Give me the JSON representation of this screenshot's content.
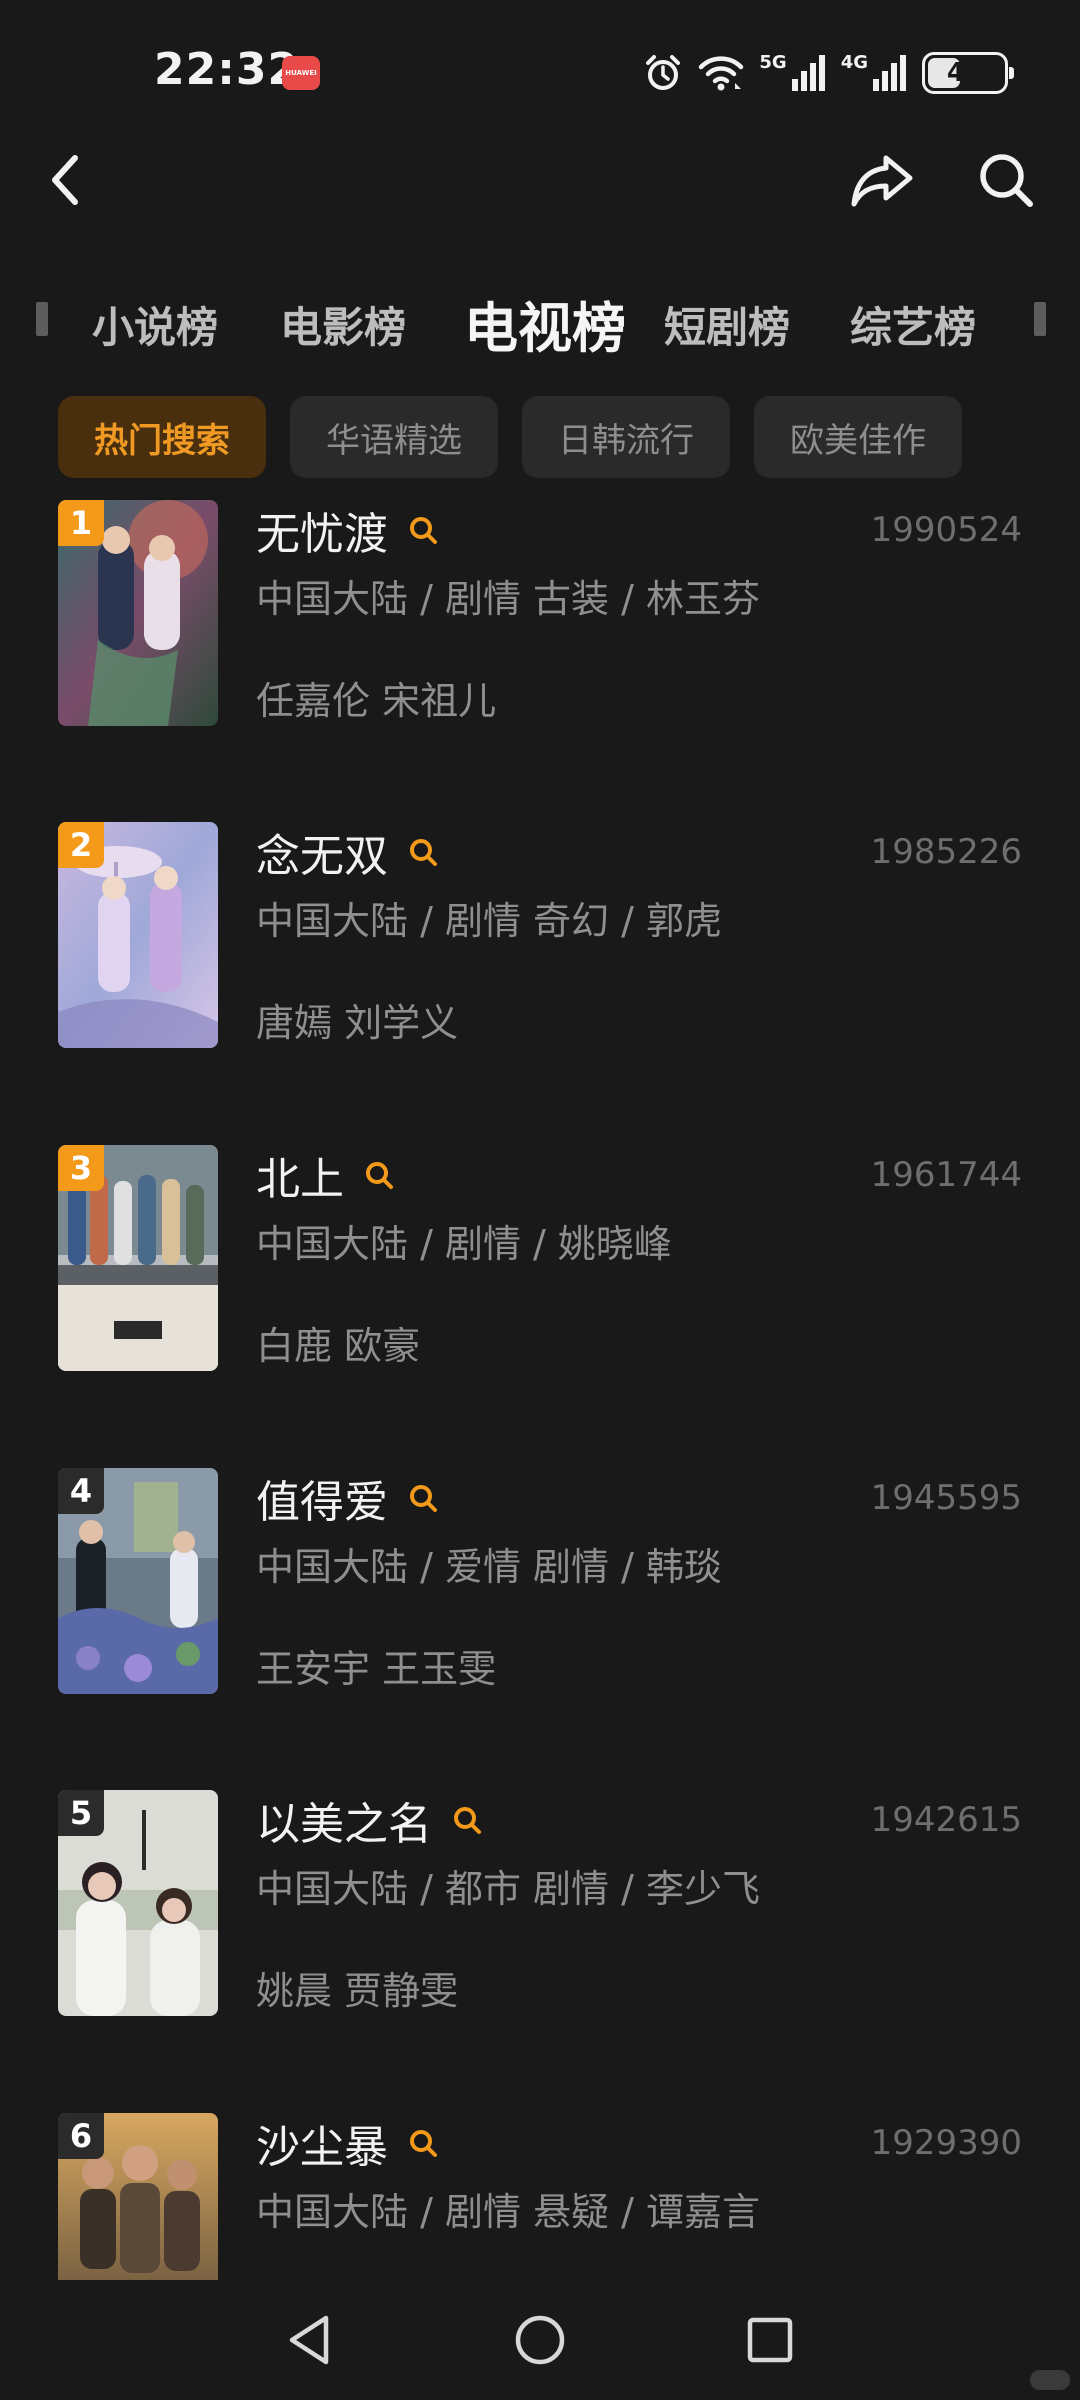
{
  "status_bar": {
    "time": "22:32",
    "brand_badge": "HUAWEI",
    "network_5g": "5G",
    "network_4g": "4G",
    "battery": "43",
    "battery_level": 0.43
  },
  "top_nav": {
    "back_icon": "chevron-left-icon",
    "share_icon": "share-icon",
    "search_icon": "search-icon"
  },
  "category_tabs": [
    {
      "label": "小说榜",
      "active": false
    },
    {
      "label": "电影榜",
      "active": false
    },
    {
      "label": "电视榜",
      "active": true
    },
    {
      "label": "短剧榜",
      "active": false
    },
    {
      "label": "综艺榜",
      "active": false
    }
  ],
  "sub_tabs": [
    {
      "label": "热门搜索",
      "active": true
    },
    {
      "label": "华语精选",
      "active": false
    },
    {
      "label": "日韩流行",
      "active": false
    },
    {
      "label": "欧美佳作",
      "active": false
    }
  ],
  "list": [
    {
      "rank": "1",
      "title": "无忧渡",
      "heat": "1990524",
      "meta": "中国大陆 / 剧情 古装 / 林玉芬",
      "cast": "任嘉伦 宋祖儿"
    },
    {
      "rank": "2",
      "title": "念无双",
      "heat": "1985226",
      "meta": "中国大陆 / 剧情 奇幻 / 郭虎",
      "cast": "唐嫣 刘学义"
    },
    {
      "rank": "3",
      "title": "北上",
      "heat": "1961744",
      "meta": "中国大陆 / 剧情 / 姚晓峰",
      "cast": "白鹿 欧豪"
    },
    {
      "rank": "4",
      "title": "值得爱",
      "heat": "1945595",
      "meta": "中国大陆 / 爱情 剧情 / 韩琰",
      "cast": "王安宇 王玉雯"
    },
    {
      "rank": "5",
      "title": "以美之名",
      "heat": "1942615",
      "meta": "中国大陆 / 都市 剧情 / 李少飞",
      "cast": "姚晨 贾静雯"
    },
    {
      "rank": "6",
      "title": "沙尘暴",
      "heat": "1929390",
      "meta": "中国大陆 / 剧情 悬疑 / 谭嘉言",
      "cast": ""
    }
  ],
  "colors": {
    "background": "#191919",
    "accent": "#f39a1b",
    "active_chip_bg": "#4a2f0e",
    "muted_text": "#8f8f8f"
  },
  "system_nav": {
    "back": "triangle-back-icon",
    "home": "circle-home-icon",
    "recent": "square-recent-icon"
  }
}
